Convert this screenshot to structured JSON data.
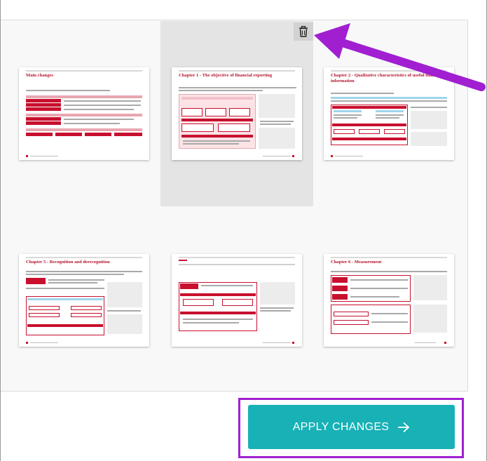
{
  "pages": [
    {
      "title": "Main changes"
    },
    {
      "title": "Chapter 1 - The objective of financial reporting"
    },
    {
      "title": "Chapter 2 - Qualitative characteristics of useful financial information"
    },
    {
      "title": "Chapter 5 - Recognition and derecognition"
    },
    {
      "title": ""
    },
    {
      "title": "Chapter 6 - Measurement"
    }
  ],
  "toolbar": {
    "delete_icon": "trash-icon"
  },
  "actions": {
    "apply_label": "APPLY CHANGES",
    "apply_icon": "arrow-right-icon"
  },
  "colors": {
    "accent": "#17b1b6",
    "highlight": "#a11fd1",
    "doc_red": "#c8102e"
  }
}
